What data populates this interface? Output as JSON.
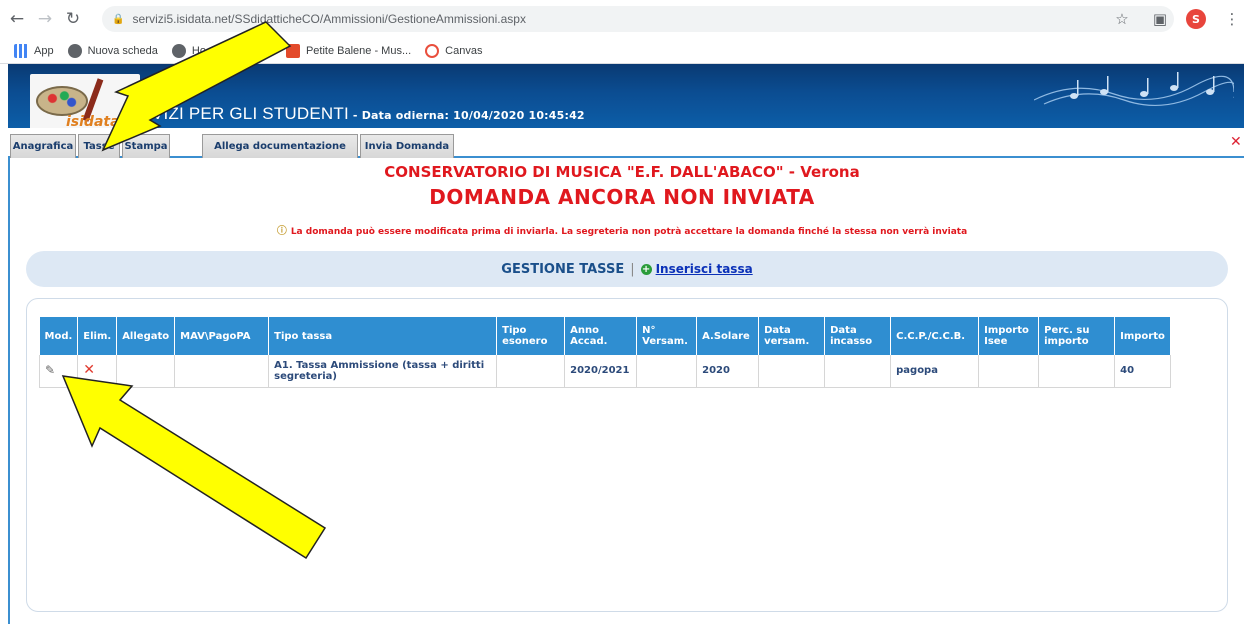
{
  "browser": {
    "url": "servizi5.isidata.net/SSdidatticheCO/Ammissioni/GestioneAmmissioni.aspx",
    "profile_initial": "S",
    "bookmarks": [
      {
        "label": "App",
        "icon": "apps-grid-icon"
      },
      {
        "label": "Nuova scheda",
        "icon": "globe-icon"
      },
      {
        "label": "Ho",
        "icon": "globe-icon"
      },
      {
        "label": "Petite Balene - Mus...",
        "icon": "music-icon"
      },
      {
        "label": "Canvas",
        "icon": "canvas-icon"
      }
    ]
  },
  "header": {
    "logo_text": "isidata",
    "title": "VIZI PER GLI STUDENTI",
    "date": " - Data odierna: 10/04/2020 10:45:42"
  },
  "tabs": [
    {
      "label": "Anagrafica"
    },
    {
      "label": "Tasse"
    },
    {
      "label": "Stampa"
    },
    {
      "label": "Allega documentazione"
    },
    {
      "label": "Invia Domanda"
    }
  ],
  "main": {
    "school": "CONSERVATORIO DI MUSICA \"E.F. DALL'ABACO\" - Verona",
    "status": "DOMANDA ANCORA NON INVIATA",
    "notice": "La domanda può essere modificata prima di inviarla. La segreteria non potrà accettare la domanda finché la stessa non verrà inviata",
    "gestione_title": "GESTIONE TASSE",
    "gestione_sep": "|",
    "add_link": "Inserisci tassa"
  },
  "table": {
    "headers": [
      "Mod.",
      "Elim.",
      "Allegato",
      "MAV\\PagoPA",
      "Tipo tassa",
      "Tipo esonero",
      "Anno Accad.",
      "N° Versam.",
      "A.Solare",
      "Data versam.",
      "Data incasso",
      "C.C.P./C.C.B.",
      "Importo Isee",
      "Perc. su importo",
      "Importo"
    ],
    "rows": [
      {
        "tipo_tassa": "A1. Tassa Ammissione (tassa + diritti segreteria)",
        "tipo_esonero": "",
        "anno_accad": "2020/2021",
        "n_versam": "",
        "a_solare": "2020",
        "data_versam": "",
        "data_incasso": "",
        "ccp": "pagopa",
        "importo_isee": "",
        "perc_importo": "",
        "importo": "40"
      }
    ]
  },
  "colors": {
    "header_blue": "#0b4d92",
    "table_header": "#2f8ed1",
    "alert_red": "#e0181e",
    "arrow_yellow": "#ffff00"
  }
}
